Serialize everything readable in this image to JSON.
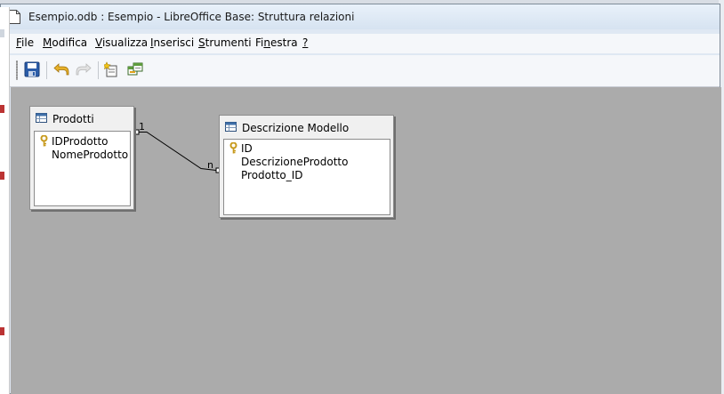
{
  "window": {
    "title": "Esempio.odb : Esempio - LibreOffice Base: Struttura relazioni"
  },
  "menu": [
    {
      "label": "File",
      "u": "F",
      "rest": "ile"
    },
    {
      "label": "Modifica",
      "u": "M",
      "rest": "odifica"
    },
    {
      "label": "Visualizza",
      "u": "V",
      "rest": "isualizza"
    },
    {
      "label": "Inserisci",
      "u": "I",
      "rest": "nserisci"
    },
    {
      "label": "Strumenti",
      "u": "S",
      "rest": "trumenti"
    },
    {
      "label": "Finestra",
      "pre": "Fi",
      "u": "n",
      "rest": "estra"
    },
    {
      "label": "?",
      "u": "?",
      "rest": ""
    }
  ],
  "toolbar": {
    "icons": [
      "save-icon",
      "undo-icon",
      "redo-icon",
      "new-relation-icon",
      "add-tables-icon"
    ]
  },
  "tables": [
    {
      "title": "Prodotti",
      "fields": [
        {
          "name": "IDProdotto",
          "key": true
        },
        {
          "name": "NomeProdotto",
          "key": false
        }
      ]
    },
    {
      "title": "Descrizione Modello",
      "fields": [
        {
          "name": "ID",
          "key": true
        },
        {
          "name": "DescrizioneProdotto",
          "key": false
        },
        {
          "name": "Prodotto_ID",
          "key": false
        }
      ]
    }
  ],
  "relation": {
    "from_cardinality": "1",
    "to_cardinality": "n"
  },
  "colors": {
    "canvas": "#ababab",
    "titlebar": "#dfe8f3",
    "save_blue": "#2b5ca8",
    "undo_yellow": "#e0a21a",
    "key_gold": "#c79a1d"
  }
}
